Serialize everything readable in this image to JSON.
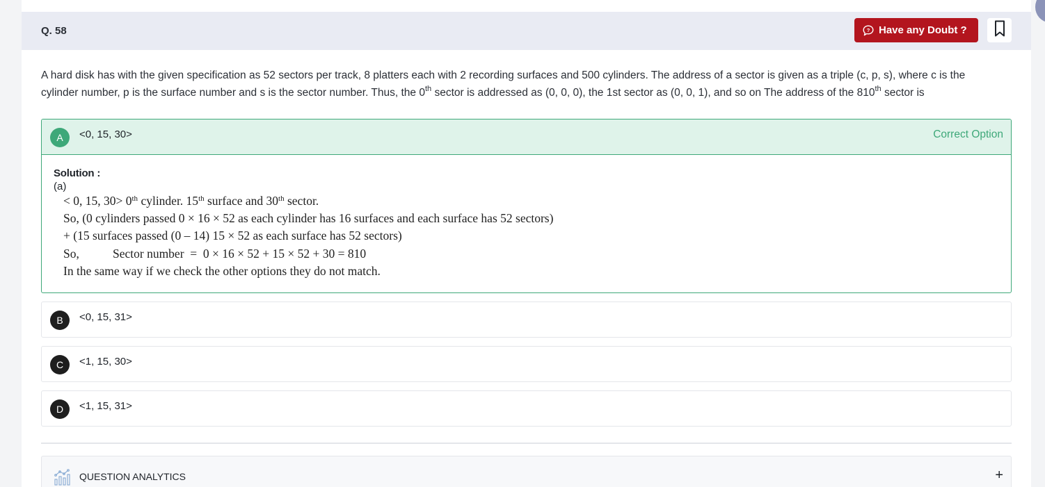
{
  "question": {
    "number": "Q. 58",
    "text_parts": [
      "A hard disk has with the given specification as 52 sectors per track, 8 platters each with 2 recording surfaces and 500 cylinders. The address of a sector is given as a triple (c, p, s), where c is the cylinder number, p is the surface number and s is the sector number. Thus, the 0",
      "th",
      " sector is addressed as (0, 0, 0), the 1st sector as (0, 0, 1), and so on The address of the 810",
      "th",
      " sector is"
    ]
  },
  "header": {
    "doubt_label": "Have any Doubt ?"
  },
  "options": [
    {
      "letter": "A",
      "text": "<0, 15, 30>",
      "status": "Correct Option"
    },
    {
      "letter": "B",
      "text": "<0, 15, 31>"
    },
    {
      "letter": "C",
      "text": "<1, 15, 30>"
    },
    {
      "letter": "D",
      "text": "<1, 15, 31>"
    }
  ],
  "solution": {
    "title": "Solution :",
    "answer": "(a)",
    "line1": {
      "a": "< 0, 15, 30> 0",
      "b": "th",
      "c": " cylinder. 15",
      "d": "th",
      "e": " surface and 30",
      "f": "th",
      "g": " sector."
    },
    "line2": "So, (0 cylinders passed 0 × 16 × 52 as each cylinder has 16 surfaces and each surface has 52 sectors)",
    "line3": "+ (15 surfaces passed (0 – 14) 15 × 52 as each surface has 52 sectors)",
    "line4": "So,           Sector number  =  0 × 16 × 52 + 15 × 52 + 30 = 810",
    "line5": "In the same way if we check the other options they do not match."
  },
  "analytics": {
    "label": "QUESTION ANALYTICS",
    "toggle": "+"
  },
  "colors": {
    "correct_green": "#3ea879",
    "doubt_red": "#b3151e",
    "header_bg": "#e9ebf3"
  }
}
